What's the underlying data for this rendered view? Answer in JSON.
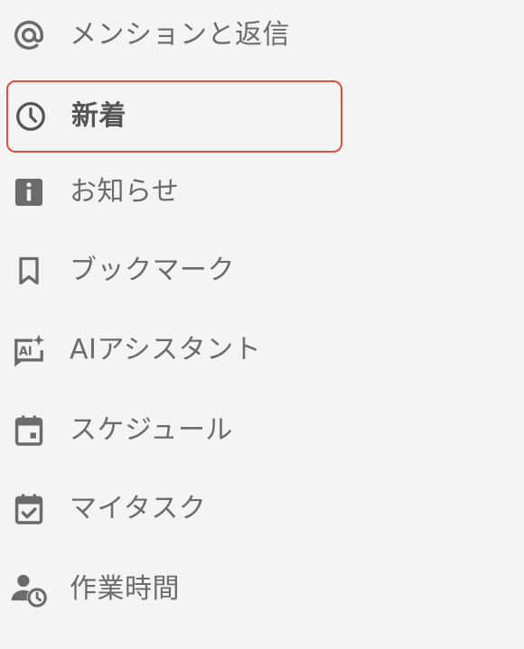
{
  "nav": {
    "accent_color": "#e0503f",
    "icon_color": "#6b6b6b",
    "items": [
      {
        "label": "メンションと返信",
        "icon": "at-icon",
        "active": false
      },
      {
        "label": "新着",
        "icon": "clock-icon",
        "active": true
      },
      {
        "label": "お知らせ",
        "icon": "info-icon",
        "active": false
      },
      {
        "label": "ブックマーク",
        "icon": "bookmark-icon",
        "active": false
      },
      {
        "label": "AIアシスタント",
        "icon": "ai-assistant-icon",
        "active": false
      },
      {
        "label": "スケジュール",
        "icon": "calendar-icon",
        "active": false
      },
      {
        "label": "マイタスク",
        "icon": "calendar-check-icon",
        "active": false
      },
      {
        "label": "作業時間",
        "icon": "user-clock-icon",
        "active": false
      }
    ]
  }
}
